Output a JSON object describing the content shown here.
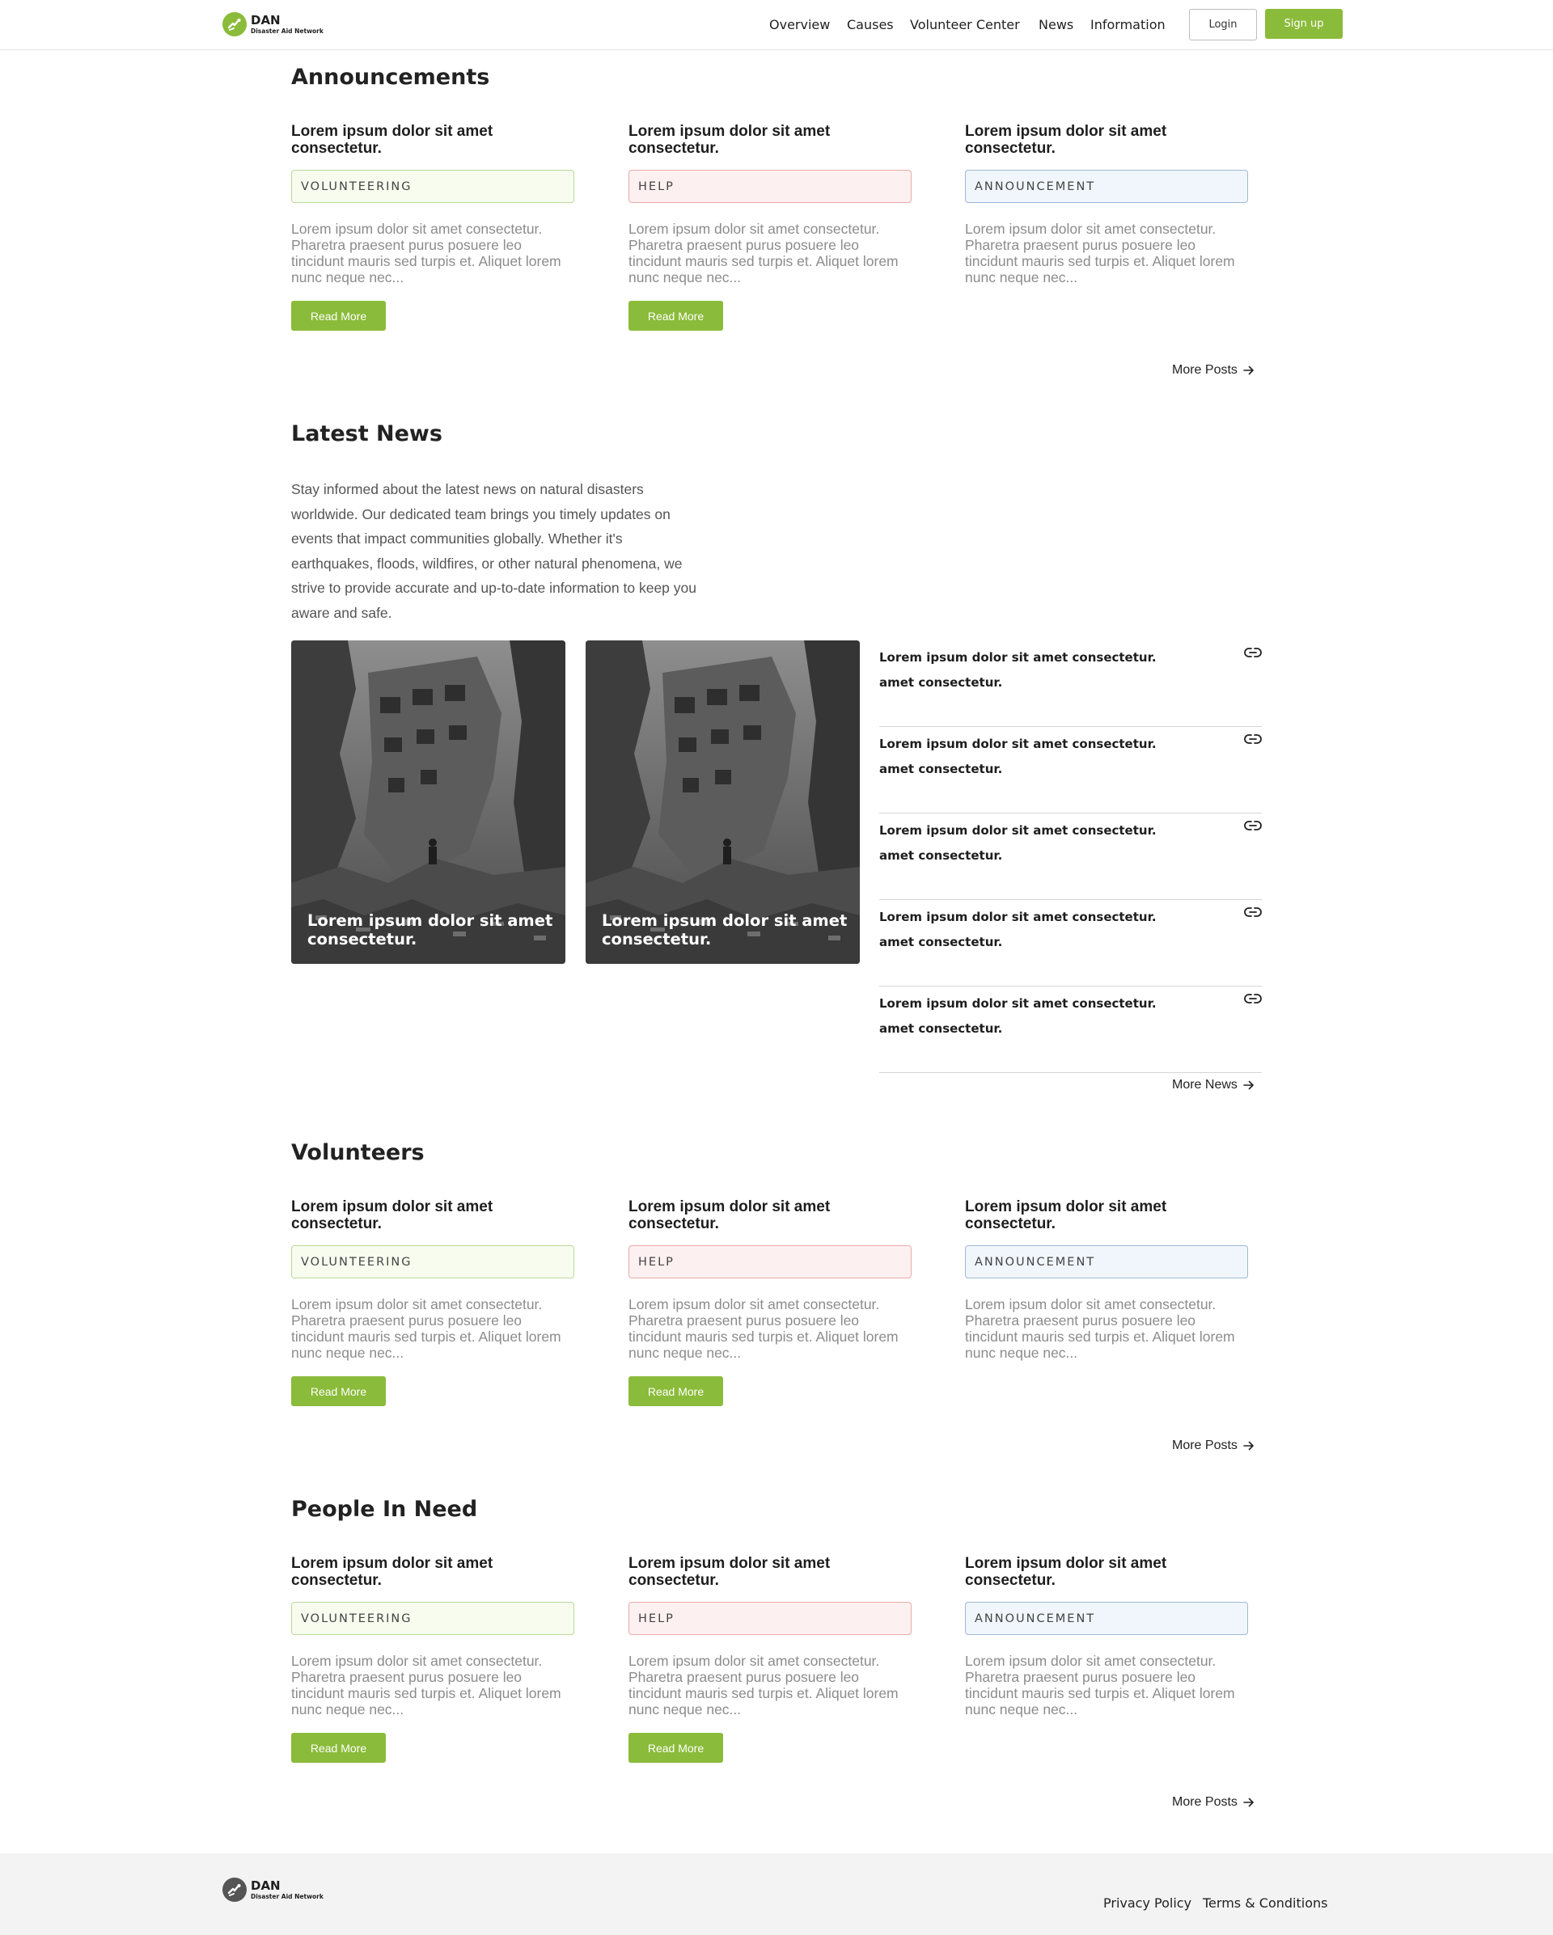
{
  "brand": {
    "name": "DAN",
    "tagline": "Disaster Aid Network",
    "accent": "#8bbb3a"
  },
  "nav": {
    "items": [
      "Overview",
      "Causes",
      "Volunteer Center",
      "News",
      "Information"
    ],
    "login": "Login",
    "signup": "Sign up"
  },
  "announcements": {
    "title": "Announcements",
    "cards": [
      {
        "title": "Lorem ipsum dolor sit amet consectetur.",
        "tag": "VOLUNTEERING",
        "desc": "Lorem ipsum dolor sit amet consectetur. Pharetra praesent purus posuere leo tincidunt mauris sed turpis et. Aliquet lorem nunc neque nec...",
        "button": "Read More"
      },
      {
        "title": "Lorem ipsum dolor sit amet consectetur.",
        "tag": "HELP",
        "desc": "Lorem ipsum dolor sit amet consectetur. Pharetra praesent purus posuere leo tincidunt mauris sed turpis et. Aliquet lorem nunc neque nec...",
        "button": "Read More"
      },
      {
        "title": "Lorem ipsum dolor sit amet consectetur.",
        "tag": "ANNOUNCEMENT",
        "desc": "Lorem ipsum dolor sit amet consectetur. Pharetra praesent purus posuere leo tincidunt mauris sed turpis et. Aliquet lorem nunc neque nec..."
      }
    ],
    "more": "More Posts"
  },
  "latest_news": {
    "title": "Latest News",
    "intro": "Stay informed about the latest news on natural disasters worldwide. Our dedicated team brings you timely updates on events that impact communities globally. Whether it's earthquakes, floods, wildfires, or other natural phenomena, we strive to provide accurate and up-to-date information to keep you aware and safe.",
    "photos": [
      {
        "caption": "Lorem ipsum dolor sit amet consectetur."
      },
      {
        "caption": "Lorem ipsum dolor sit amet consectetur."
      }
    ],
    "list": [
      "Lorem ipsum dolor sit amet consectetur. amet consectetur.",
      "Lorem ipsum dolor sit amet consectetur. amet consectetur.",
      "Lorem ipsum dolor sit amet consectetur. amet consectetur.",
      "Lorem ipsum dolor sit amet consectetur. amet consectetur.",
      "Lorem ipsum dolor sit amet consectetur. amet consectetur."
    ],
    "more": "More News"
  },
  "volunteers": {
    "title": "Volunteers",
    "cards": [
      {
        "title": "Lorem ipsum dolor sit amet consectetur.",
        "tag": "VOLUNTEERING",
        "desc": "Lorem ipsum dolor sit amet consectetur. Pharetra praesent purus posuere leo tincidunt mauris sed turpis et. Aliquet lorem nunc neque nec...",
        "button": "Read More"
      },
      {
        "title": "Lorem ipsum dolor sit amet consectetur.",
        "tag": "HELP",
        "desc": "Lorem ipsum dolor sit amet consectetur. Pharetra praesent purus posuere leo tincidunt mauris sed turpis et. Aliquet lorem nunc neque nec...",
        "button": "Read More"
      },
      {
        "title": "Lorem ipsum dolor sit amet consectetur.",
        "tag": "ANNOUNCEMENT",
        "desc": "Lorem ipsum dolor sit amet consectetur. Pharetra praesent purus posuere leo tincidunt mauris sed turpis et. Aliquet lorem nunc neque nec..."
      }
    ],
    "more": "More Posts"
  },
  "people_in_need": {
    "title": "People In Need",
    "cards": [
      {
        "title": "Lorem ipsum dolor sit amet consectetur.",
        "tag": "VOLUNTEERING",
        "desc": "Lorem ipsum dolor sit amet consectetur. Pharetra praesent purus posuere leo tincidunt mauris sed turpis et. Aliquet lorem nunc neque nec...",
        "button": "Read More"
      },
      {
        "title": "Lorem ipsum dolor sit amet consectetur.",
        "tag": "HELP",
        "desc": "Lorem ipsum dolor sit amet consectetur. Pharetra praesent purus posuere leo tincidunt mauris sed turpis et. Aliquet lorem nunc neque nec...",
        "button": "Read More"
      },
      {
        "title": "Lorem ipsum dolor sit amet consectetur.",
        "tag": "ANNOUNCEMENT",
        "desc": "Lorem ipsum dolor sit amet consectetur. Pharetra praesent purus posuere leo tincidunt mauris sed turpis et. Aliquet lorem nunc neque nec..."
      }
    ],
    "more": "More Posts"
  },
  "footer": {
    "privacy": "Privacy Policy",
    "terms": "Terms & Conditions"
  },
  "icons": {
    "logo": "hand-heart-icon",
    "more": "arrow-right-icon",
    "news_link": "link-icon"
  }
}
